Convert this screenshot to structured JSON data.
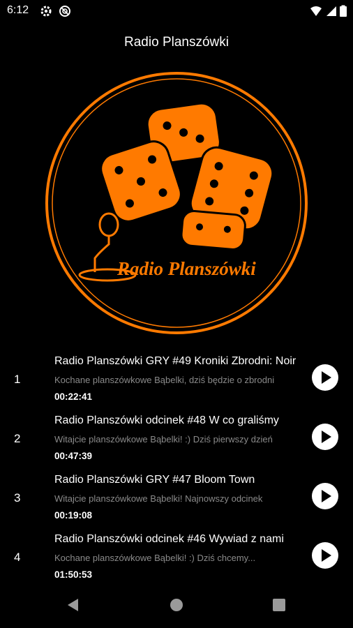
{
  "status": {
    "time": "6:12"
  },
  "app": {
    "title": "Radio Planszówki"
  },
  "logo": {
    "text": "Radio Planszówki",
    "accent": "#ff7a00"
  },
  "episodes": [
    {
      "num": "1",
      "title": "Radio Planszówki GRY #49 Kroniki Zbrodni: Noir",
      "desc": "Kochane planszówkowe Bąbelki, dziś będzie o zbrodni",
      "duration": "00:22:41"
    },
    {
      "num": "2",
      "title": "Radio Planszówki odcinek #48 W co graliśmy",
      "desc": "Witajcie planszówkowe Bąbelki! :) Dziś pierwszy dzień",
      "duration": "00:47:39"
    },
    {
      "num": "3",
      "title": "Radio Planszówki GRY #47 Bloom Town",
      "desc": "Witajcie planszówkowe Bąbelki! Najnowszy odcinek",
      "duration": "00:19:08"
    },
    {
      "num": "4",
      "title": "Radio Planszówki odcinek #46 Wywiad z nami",
      "desc": "Kochane planszówkowe Bąbelki! :) Dziś chcemy...",
      "duration": "01:50:53"
    }
  ],
  "icons": {
    "play": "play-icon",
    "back": "back-icon",
    "home": "home-icon",
    "recents": "recents-icon",
    "settings": "gear-icon",
    "dnd": "do-not-disturb-icon",
    "wifi": "wifi-icon",
    "battery": "battery-icon"
  }
}
